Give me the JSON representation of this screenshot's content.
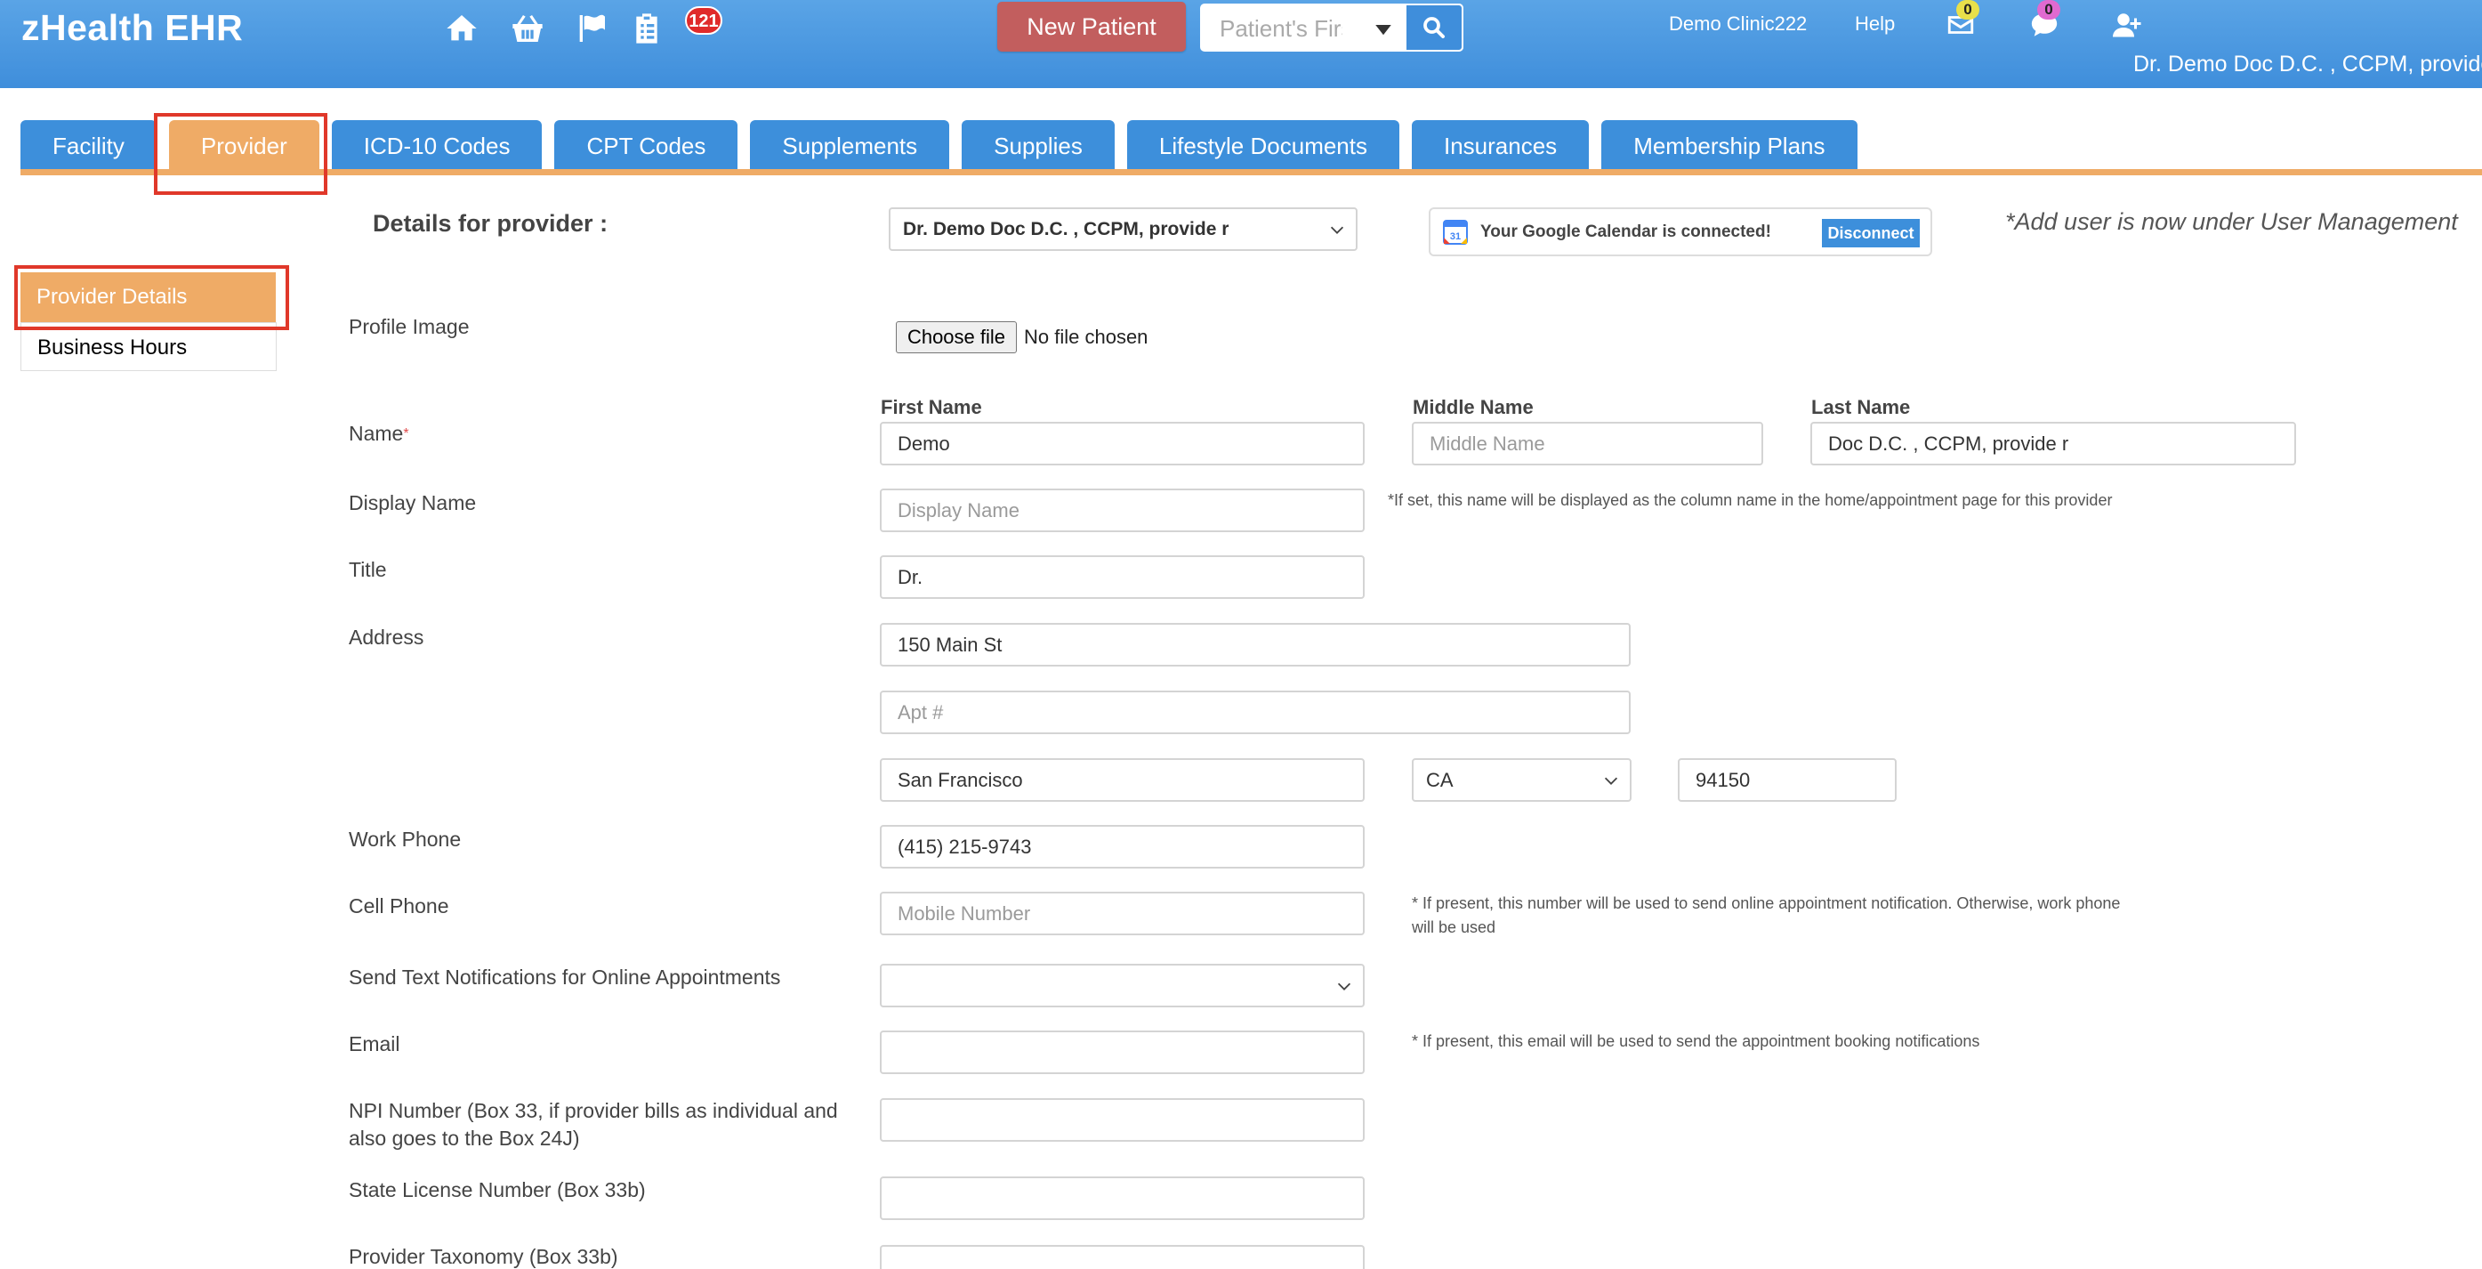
{
  "header": {
    "logo": "zHealth EHR",
    "icons": [
      "home-icon",
      "basket-icon",
      "flag-icon",
      "clipboard-icon"
    ],
    "task_badge": "121",
    "new_patient_label": "New Patient",
    "search_placeholder": "Patient's First Name",
    "clinic": "Demo Clinic222",
    "help": "Help",
    "mail_badge": "0",
    "chat_badge": "0",
    "logged_in_as": "Dr. Demo Doc D.C. , CCPM, provide r"
  },
  "tabs": [
    {
      "label": "Facility"
    },
    {
      "label": "Provider"
    },
    {
      "label": "ICD-10 Codes"
    },
    {
      "label": "CPT Codes"
    },
    {
      "label": "Supplements"
    },
    {
      "label": "Supplies"
    },
    {
      "label": "Lifestyle Documents"
    },
    {
      "label": "Insurances"
    },
    {
      "label": "Membership Plans"
    }
  ],
  "active_tab": "Provider",
  "sidebar": {
    "items": [
      {
        "label": "Provider Details"
      },
      {
        "label": "Business Hours"
      }
    ]
  },
  "form": {
    "details_label": "Details for provider :",
    "provider_select": "Dr. Demo Doc D.C. , CCPM, provide r",
    "gcal_text": "Your Google Calendar is connected!",
    "gcal_button": "Disconnect",
    "add_user_note": "*Add user is now under User Management",
    "profile_image_label": "Profile Image",
    "choose_file": "Choose file",
    "no_file": "No file chosen",
    "name_label": "Name",
    "name_required": "*",
    "first_name_head": "First Name",
    "middle_name_head": "Middle Name",
    "last_name_head": "Last Name",
    "first_name": "Demo",
    "middle_name_placeholder": "Middle Name",
    "last_name": "Doc D.C. , CCPM, provide r",
    "display_name_label": "Display Name",
    "display_name_placeholder": "Display Name",
    "display_name_note": "*If set, this name will be displayed as the column name in the home/appointment page for this provider",
    "title_label": "Title",
    "title": "Dr.",
    "address_label": "Address",
    "address1": "150 Main St",
    "address2_placeholder": "Apt #",
    "city": "San Francisco",
    "state": "CA",
    "zip": "94150",
    "work_phone_label": "Work Phone",
    "work_phone": "(415) 215-9743",
    "cell_phone_label": "Cell Phone",
    "cell_phone_placeholder": "Mobile Number",
    "cell_phone_note_1": "* If present, this number will be used to send online appointment notification. Otherwise, work phone",
    "cell_phone_note_2": "will be used",
    "send_text_label": "Send Text Notifications for Online Appointments",
    "send_text_value": "",
    "email_label": "Email",
    "email": "",
    "email_note": "* If present, this email will be used to send the appointment booking notifications",
    "npi_label_1": "NPI Number (Box 33, if provider bills as individual and",
    "npi_label_2": "also goes to the Box 24J)",
    "npi": "",
    "state_license_label": "State License Number (Box 33b)",
    "state_license": "",
    "taxonomy_label": "Provider Taxonomy (Box 33b)"
  },
  "colors": {
    "header_blue": "#3f8edb",
    "tab_blue": "#3d8fdb",
    "active_orange": "#efab66",
    "new_patient_red": "#c25e5e",
    "highlight_red": "#e0382a"
  }
}
